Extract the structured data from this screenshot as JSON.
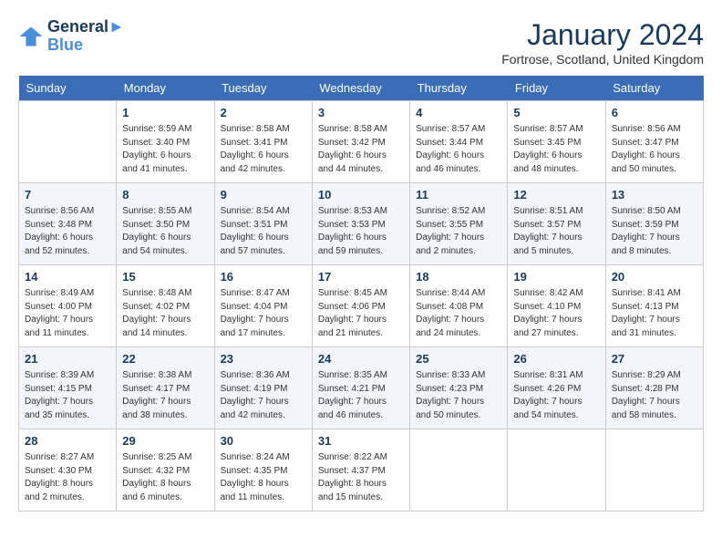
{
  "header": {
    "logo_line1": "General",
    "logo_line2": "Blue",
    "month_title": "January 2024",
    "location": "Fortrose, Scotland, United Kingdom"
  },
  "days_of_week": [
    "Sunday",
    "Monday",
    "Tuesday",
    "Wednesday",
    "Thursday",
    "Friday",
    "Saturday"
  ],
  "weeks": [
    [
      {
        "day": "",
        "info": ""
      },
      {
        "day": "1",
        "info": "Sunrise: 8:59 AM\nSunset: 3:40 PM\nDaylight: 6 hours\nand 41 minutes."
      },
      {
        "day": "2",
        "info": "Sunrise: 8:58 AM\nSunset: 3:41 PM\nDaylight: 6 hours\nand 42 minutes."
      },
      {
        "day": "3",
        "info": "Sunrise: 8:58 AM\nSunset: 3:42 PM\nDaylight: 6 hours\nand 44 minutes."
      },
      {
        "day": "4",
        "info": "Sunrise: 8:57 AM\nSunset: 3:44 PM\nDaylight: 6 hours\nand 46 minutes."
      },
      {
        "day": "5",
        "info": "Sunrise: 8:57 AM\nSunset: 3:45 PM\nDaylight: 6 hours\nand 48 minutes."
      },
      {
        "day": "6",
        "info": "Sunrise: 8:56 AM\nSunset: 3:47 PM\nDaylight: 6 hours\nand 50 minutes."
      }
    ],
    [
      {
        "day": "7",
        "info": "Sunrise: 8:56 AM\nSunset: 3:48 PM\nDaylight: 6 hours\nand 52 minutes."
      },
      {
        "day": "8",
        "info": "Sunrise: 8:55 AM\nSunset: 3:50 PM\nDaylight: 6 hours\nand 54 minutes."
      },
      {
        "day": "9",
        "info": "Sunrise: 8:54 AM\nSunset: 3:51 PM\nDaylight: 6 hours\nand 57 minutes."
      },
      {
        "day": "10",
        "info": "Sunrise: 8:53 AM\nSunset: 3:53 PM\nDaylight: 6 hours\nand 59 minutes."
      },
      {
        "day": "11",
        "info": "Sunrise: 8:52 AM\nSunset: 3:55 PM\nDaylight: 7 hours\nand 2 minutes."
      },
      {
        "day": "12",
        "info": "Sunrise: 8:51 AM\nSunset: 3:57 PM\nDaylight: 7 hours\nand 5 minutes."
      },
      {
        "day": "13",
        "info": "Sunrise: 8:50 AM\nSunset: 3:59 PM\nDaylight: 7 hours\nand 8 minutes."
      }
    ],
    [
      {
        "day": "14",
        "info": "Sunrise: 8:49 AM\nSunset: 4:00 PM\nDaylight: 7 hours\nand 11 minutes."
      },
      {
        "day": "15",
        "info": "Sunrise: 8:48 AM\nSunset: 4:02 PM\nDaylight: 7 hours\nand 14 minutes."
      },
      {
        "day": "16",
        "info": "Sunrise: 8:47 AM\nSunset: 4:04 PM\nDaylight: 7 hours\nand 17 minutes."
      },
      {
        "day": "17",
        "info": "Sunrise: 8:45 AM\nSunset: 4:06 PM\nDaylight: 7 hours\nand 21 minutes."
      },
      {
        "day": "18",
        "info": "Sunrise: 8:44 AM\nSunset: 4:08 PM\nDaylight: 7 hours\nand 24 minutes."
      },
      {
        "day": "19",
        "info": "Sunrise: 8:42 AM\nSunset: 4:10 PM\nDaylight: 7 hours\nand 27 minutes."
      },
      {
        "day": "20",
        "info": "Sunrise: 8:41 AM\nSunset: 4:13 PM\nDaylight: 7 hours\nand 31 minutes."
      }
    ],
    [
      {
        "day": "21",
        "info": "Sunrise: 8:39 AM\nSunset: 4:15 PM\nDaylight: 7 hours\nand 35 minutes."
      },
      {
        "day": "22",
        "info": "Sunrise: 8:38 AM\nSunset: 4:17 PM\nDaylight: 7 hours\nand 38 minutes."
      },
      {
        "day": "23",
        "info": "Sunrise: 8:36 AM\nSunset: 4:19 PM\nDaylight: 7 hours\nand 42 minutes."
      },
      {
        "day": "24",
        "info": "Sunrise: 8:35 AM\nSunset: 4:21 PM\nDaylight: 7 hours\nand 46 minutes."
      },
      {
        "day": "25",
        "info": "Sunrise: 8:33 AM\nSunset: 4:23 PM\nDaylight: 7 hours\nand 50 minutes."
      },
      {
        "day": "26",
        "info": "Sunrise: 8:31 AM\nSunset: 4:26 PM\nDaylight: 7 hours\nand 54 minutes."
      },
      {
        "day": "27",
        "info": "Sunrise: 8:29 AM\nSunset: 4:28 PM\nDaylight: 7 hours\nand 58 minutes."
      }
    ],
    [
      {
        "day": "28",
        "info": "Sunrise: 8:27 AM\nSunset: 4:30 PM\nDaylight: 8 hours\nand 2 minutes."
      },
      {
        "day": "29",
        "info": "Sunrise: 8:25 AM\nSunset: 4:32 PM\nDaylight: 8 hours\nand 6 minutes."
      },
      {
        "day": "30",
        "info": "Sunrise: 8:24 AM\nSunset: 4:35 PM\nDaylight: 8 hours\nand 11 minutes."
      },
      {
        "day": "31",
        "info": "Sunrise: 8:22 AM\nSunset: 4:37 PM\nDaylight: 8 hours\nand 15 minutes."
      },
      {
        "day": "",
        "info": ""
      },
      {
        "day": "",
        "info": ""
      },
      {
        "day": "",
        "info": ""
      }
    ]
  ]
}
